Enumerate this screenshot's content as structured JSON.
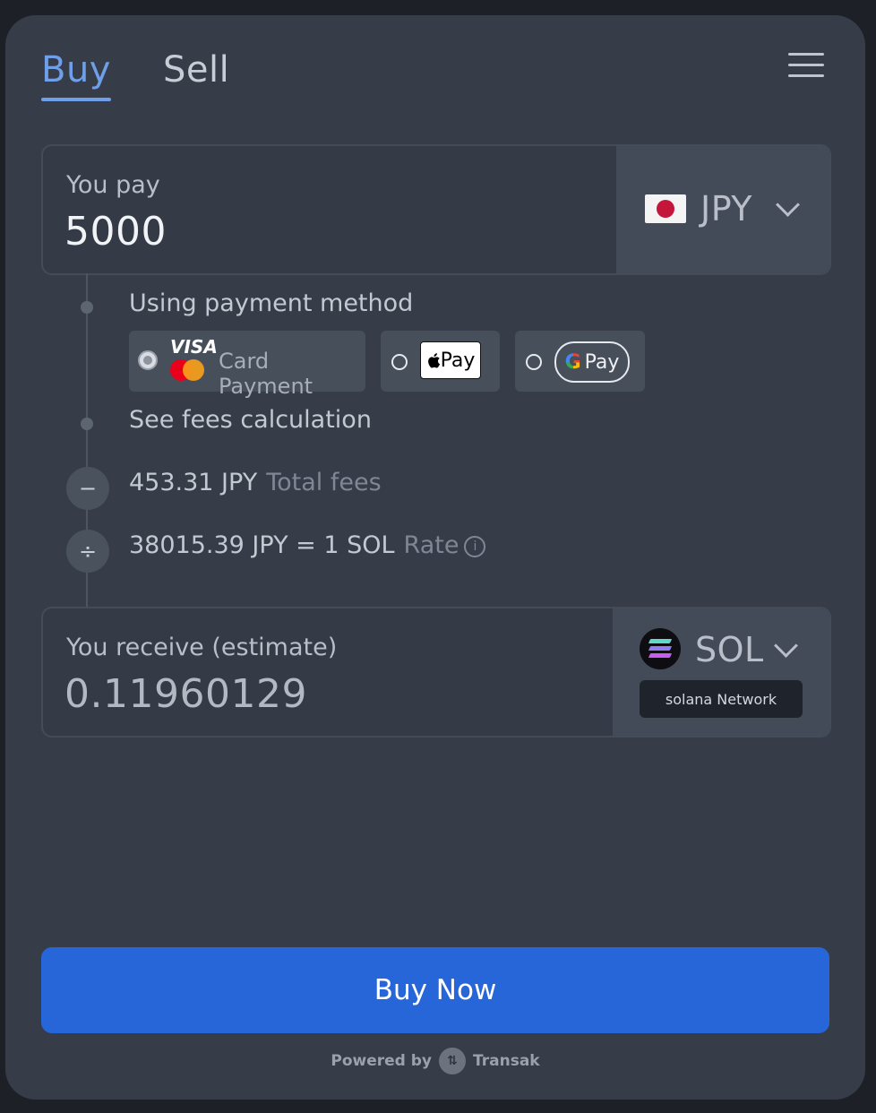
{
  "tabs": {
    "buy": "Buy",
    "sell": "Sell"
  },
  "pay": {
    "label": "You pay",
    "amount": "5000",
    "currency": "JPY"
  },
  "steps": {
    "payment_method_label": "Using payment method",
    "fees_label": "See fees calculation",
    "total_fees_value": "453.31 JPY",
    "total_fees_label": "Total fees",
    "rate_value": "38015.39 JPY = 1 SOL",
    "rate_label": "Rate",
    "minus_symbol": "−",
    "divide_symbol": "÷"
  },
  "payment_methods": {
    "card": {
      "brand_text": "VISA",
      "label": "Card Payment",
      "selected": true
    },
    "apple": {
      "text": "Pay"
    },
    "google": {
      "g": "G",
      "text": "Pay"
    }
  },
  "receive": {
    "label": "You receive (estimate)",
    "amount": "0.11960129",
    "currency": "SOL",
    "network": "solana Network"
  },
  "buy_button": "Buy Now",
  "footer": {
    "powered_by": "Powered by",
    "brand": "Transak"
  },
  "colors": {
    "accent": "#2766d8",
    "tab_active": "#6f9fe8",
    "background": "#363d49"
  },
  "icons": {
    "menu": "hamburger-icon",
    "info": "info-icon",
    "chevron": "chevron-down-icon"
  }
}
